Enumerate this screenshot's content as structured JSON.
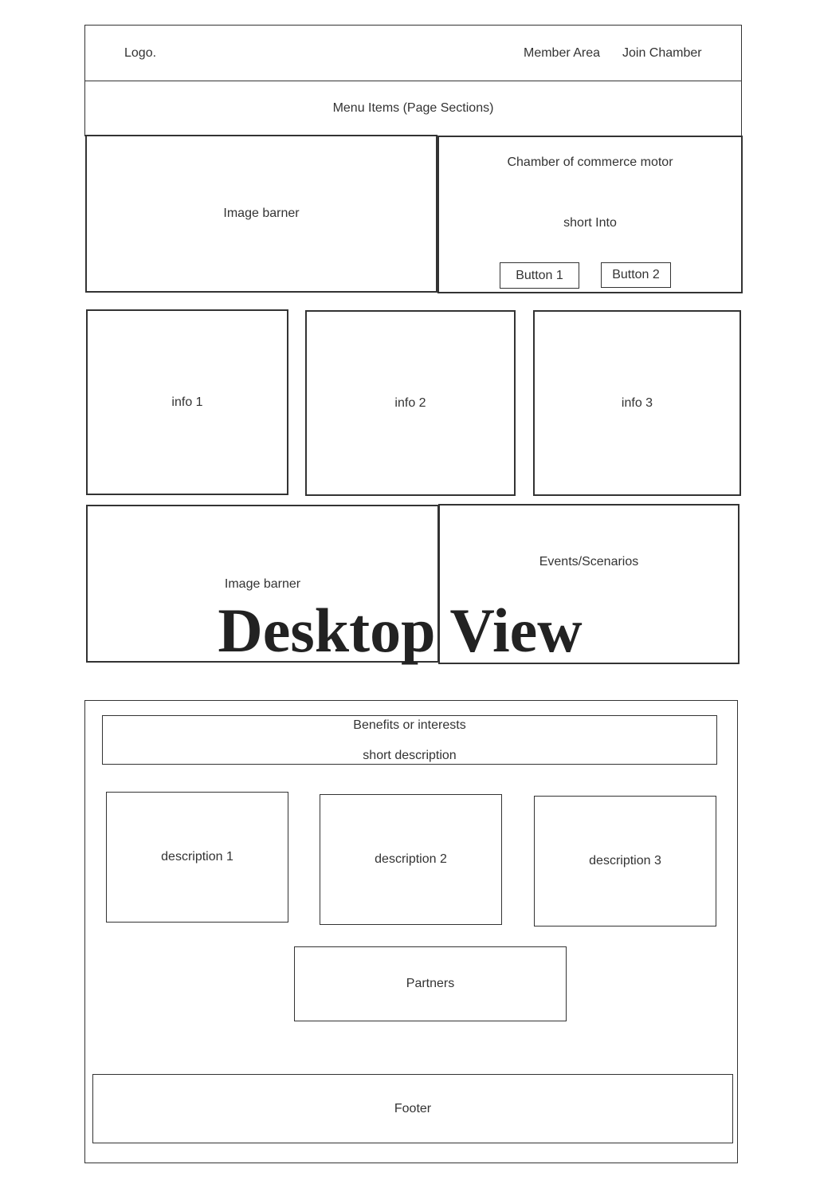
{
  "header": {
    "logo": "Logo.",
    "member_area": "Member Area",
    "join_chamber": "Join Chamber"
  },
  "menu": {
    "label": "Menu Items (Page Sections)"
  },
  "hero": {
    "image_label": "Image barner",
    "title": "Chamber of commerce motor",
    "intro": "short Into",
    "button1": "Button 1",
    "button2": "Button 2"
  },
  "info": {
    "items": [
      "info 1",
      "info 2",
      "info 3"
    ]
  },
  "events_row": {
    "image_label": "Image barner",
    "events_label": "Events/Scenarios"
  },
  "view_title": "Desktop View",
  "benefits": {
    "title": "Benefits or interests",
    "description": "short description",
    "items": [
      "description 1",
      "description 2",
      "description 3"
    ]
  },
  "partners": {
    "label": "Partners"
  },
  "footer": {
    "label": "Footer"
  }
}
